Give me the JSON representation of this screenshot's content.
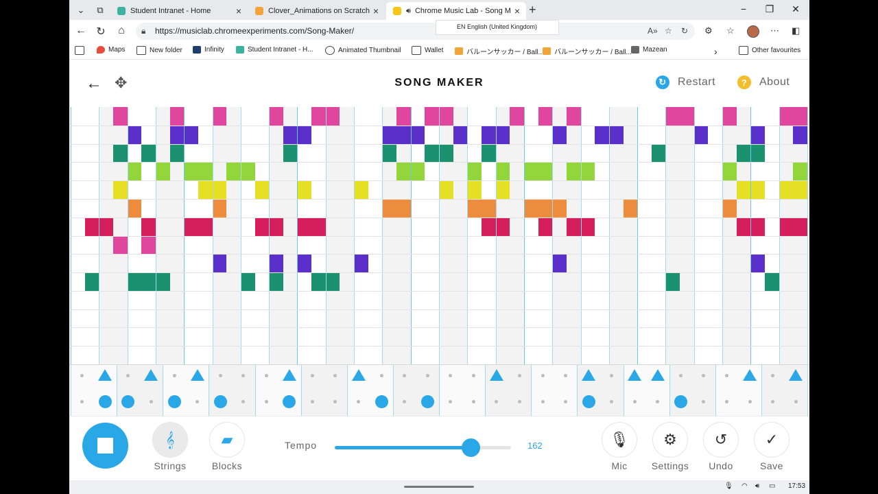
{
  "browser": {
    "tabs": [
      {
        "title": "Student Intranet - Home",
        "color": "#3bb3a0"
      },
      {
        "title": "Clover_Animations on Scratch",
        "color": "#f2a43a"
      },
      {
        "title": "Chrome Music Lab - Song M",
        "color": "#f5c518"
      }
    ],
    "url": "https://musiclab.chromeexperiments.com/Song-Maker/",
    "translate_popup": "EN English (United Kingdom)",
    "bookmarks": [
      "Maps",
      "New folder",
      "Infinity",
      "Student Intranet - H...",
      "Animated Thumbnail",
      "Wallet",
      "バルーンサッカー / Ball...",
      "バルーンサッカー / Ball...",
      "Mazean"
    ],
    "other_bookmarks": "Other favourites"
  },
  "app": {
    "title": "SONG MAKER",
    "restart_label": "Restart",
    "about_label": "About",
    "about_glyph": "?",
    "tempo_label": "Tempo",
    "tempo_value": "162",
    "tempo_fraction": 0.77,
    "instrument_label": "Strings",
    "percussion_label": "Blocks",
    "mic_label": "Mic",
    "settings_label": "Settings",
    "undo_label": "Undo",
    "save_label": "Save"
  },
  "row_colors": [
    "#e0469e",
    "#5b2fc9",
    "#1c9170",
    "#93d63c",
    "#e6e025",
    "#ec8c3c",
    "#d51e5c",
    "#e0469e",
    "#5b2fc9",
    "#1c9170",
    "#93d63c",
    "#e6e025",
    "#ec8c3c",
    "#d51e5c"
  ],
  "grid_rows": [
    "0001000100100010011000010110000101010000001100100011",
    "0000100110000001100000111001011000100110000010001001",
    "0001010100000001000000100110010000000000010000011000",
    "0000101011011000000000011000101011011000000000100001",
    "0001000001100100100010000010101000000000000000011011",
    "0000100000100000000000110000110011100001000000100000",
    "0110010011000110110000000000011001011000000000011011",
    "0001010000000000000000000000000000000000000000000000",
    "0000000000100010100010000000000000100000000000001000",
    "0100111000001010011000000000000000000000001000000100",
    "0000000000000000000000000000000000000000000000000000",
    "0000000000000000000000000000000000000000000000000000",
    "0000000000000000000000000000000000000000000000000000",
    "0000000000000000000000000000000000000000000000000000"
  ],
  "percussion": {
    "top": [
      0,
      1,
      0,
      1,
      0,
      1,
      0,
      0,
      0,
      1,
      0,
      0,
      1,
      0,
      0,
      0,
      0,
      0,
      1,
      0,
      0,
      0,
      1,
      0,
      1,
      1,
      0,
      0,
      0,
      1,
      0,
      1
    ],
    "bottom": [
      0,
      1,
      1,
      0,
      1,
      0,
      1,
      0,
      0,
      1,
      0,
      0,
      0,
      1,
      0,
      1,
      0,
      0,
      0,
      0,
      0,
      0,
      1,
      0,
      0,
      0,
      1,
      0,
      0,
      0,
      0,
      0
    ]
  },
  "system": {
    "time": "17:53"
  }
}
